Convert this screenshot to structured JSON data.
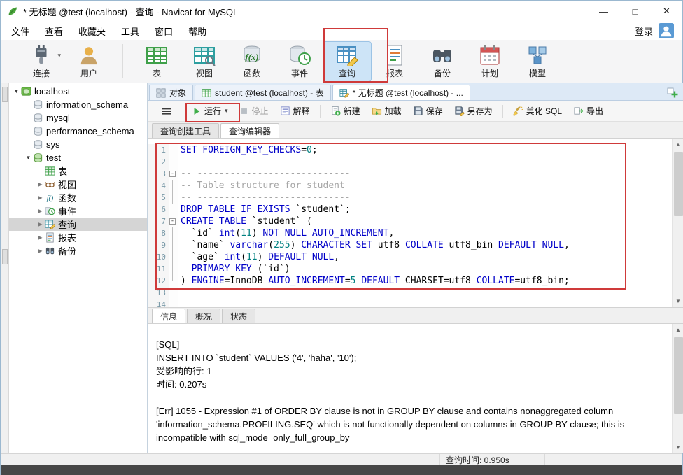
{
  "titlebar": {
    "title": "* 无标题 @test (localhost) - 查询 - Navicat for MySQL",
    "controls": {
      "minimize": "—",
      "maximize": "□",
      "close": "✕"
    }
  },
  "menubar": {
    "items": [
      "文件",
      "查看",
      "收藏夹",
      "工具",
      "窗口",
      "帮助"
    ],
    "login_label": "登录"
  },
  "toolbar": {
    "items": [
      {
        "label": "连接",
        "icon": "connection",
        "dropdown": true
      },
      {
        "label": "用户",
        "icon": "user",
        "sep_after": true
      },
      {
        "label": "表",
        "icon": "table"
      },
      {
        "label": "视图",
        "icon": "view"
      },
      {
        "label": "函数",
        "icon": "function"
      },
      {
        "label": "事件",
        "icon": "event"
      },
      {
        "label": "查询",
        "icon": "query",
        "selected": true
      },
      {
        "label": "报表",
        "icon": "report"
      },
      {
        "label": "备份",
        "icon": "backup"
      },
      {
        "label": "计划",
        "icon": "plan"
      },
      {
        "label": "模型",
        "icon": "model"
      }
    ]
  },
  "sidebar": {
    "items": [
      {
        "label": "localhost",
        "depth": 0,
        "icon": "db-localhost",
        "arrow": "down"
      },
      {
        "label": "information_schema",
        "depth": 1,
        "icon": "db-gray"
      },
      {
        "label": "mysql",
        "depth": 1,
        "icon": "db-gray"
      },
      {
        "label": "performance_schema",
        "depth": 1,
        "icon": "db-gray"
      },
      {
        "label": "sys",
        "depth": 1,
        "icon": "db-gray"
      },
      {
        "label": "test",
        "depth": 1,
        "icon": "db-green",
        "arrow": "down"
      },
      {
        "label": "表",
        "depth": 2,
        "icon": "tree-table"
      },
      {
        "label": "视图",
        "depth": 2,
        "icon": "tree-view",
        "arrow": "right"
      },
      {
        "label": "函数",
        "depth": 2,
        "icon": "tree-function",
        "arrow": "right"
      },
      {
        "label": "事件",
        "depth": 2,
        "icon": "tree-event",
        "arrow": "right"
      },
      {
        "label": "查询",
        "depth": 2,
        "icon": "tree-query",
        "arrow": "right",
        "selected": true
      },
      {
        "label": "报表",
        "depth": 2,
        "icon": "tree-report",
        "arrow": "right"
      },
      {
        "label": "备份",
        "depth": 2,
        "icon": "tree-backup",
        "arrow": "right"
      }
    ]
  },
  "tabbar": {
    "tabs": [
      {
        "label": "对象",
        "icon": "tab-objects"
      },
      {
        "label": "student @test (localhost) - 表",
        "icon": "tab-table"
      },
      {
        "label": "* 无标题 @test (localhost) - ...",
        "icon": "tab-query",
        "active": true
      }
    ]
  },
  "querybar": {
    "buttons": [
      {
        "id": "menu",
        "icon": "menu"
      },
      {
        "id": "run",
        "label": "运行",
        "icon": "run",
        "dropdown": true
      },
      {
        "id": "stop",
        "label": "停止",
        "icon": "stop",
        "disabled": true
      },
      {
        "id": "explain",
        "label": "解释",
        "icon": "explain",
        "sep_after": true
      },
      {
        "id": "new",
        "label": "新建",
        "icon": "new"
      },
      {
        "id": "load",
        "label": "加载",
        "icon": "load"
      },
      {
        "id": "save",
        "label": "保存",
        "icon": "save"
      },
      {
        "id": "saveas",
        "label": "另存为",
        "icon": "saveas",
        "sep_after": true
      },
      {
        "id": "beautify",
        "label": "美化 SQL",
        "icon": "beautify"
      },
      {
        "id": "export",
        "label": "导出",
        "icon": "export"
      }
    ]
  },
  "editor_tabs": [
    {
      "label": "查询创建工具"
    },
    {
      "label": "查询编辑器",
      "active": true
    }
  ],
  "editor": {
    "lines": [
      {
        "n": 1,
        "f": "",
        "t": [
          [
            "k",
            "SET FOREIGN_KEY_CHECKS"
          ],
          [
            "p",
            "="
          ],
          [
            "n",
            "0"
          ],
          [
            "p",
            ";"
          ]
        ]
      },
      {
        "n": 2,
        "f": "",
        "t": []
      },
      {
        "n": 3,
        "f": "box",
        "t": [
          [
            "c",
            "-- ----------------------------"
          ]
        ]
      },
      {
        "n": 4,
        "f": "v",
        "t": [
          [
            "c",
            "-- Table structure for student"
          ]
        ]
      },
      {
        "n": 5,
        "f": "v",
        "t": [
          [
            "c",
            "-- ----------------------------"
          ]
        ]
      },
      {
        "n": 6,
        "f": "",
        "t": [
          [
            "k",
            "DROP TABLE IF EXISTS"
          ],
          [
            "p",
            " `student`;"
          ]
        ]
      },
      {
        "n": 7,
        "f": "box",
        "t": [
          [
            "k",
            "CREATE TABLE"
          ],
          [
            "p",
            " `student` ("
          ]
        ]
      },
      {
        "n": 8,
        "f": "v",
        "t": [
          [
            "p",
            "  `id` "
          ],
          [
            "k",
            "int"
          ],
          [
            "p",
            "("
          ],
          [
            "n",
            "11"
          ],
          [
            "p",
            ") "
          ],
          [
            "k",
            "NOT NULL AUTO_INCREMENT"
          ],
          [
            "p",
            ","
          ]
        ]
      },
      {
        "n": 9,
        "f": "v",
        "t": [
          [
            "p",
            "  `name` "
          ],
          [
            "k",
            "varchar"
          ],
          [
            "p",
            "("
          ],
          [
            "n",
            "255"
          ],
          [
            "p",
            ") "
          ],
          [
            "k",
            "CHARACTER SET"
          ],
          [
            "p",
            " utf8 "
          ],
          [
            "k",
            "COLLATE"
          ],
          [
            "p",
            " utf8_bin "
          ],
          [
            "k",
            "DEFAULT NULL"
          ],
          [
            "p",
            ","
          ]
        ]
      },
      {
        "n": 10,
        "f": "v",
        "t": [
          [
            "p",
            "  `age` "
          ],
          [
            "k",
            "int"
          ],
          [
            "p",
            "("
          ],
          [
            "n",
            "11"
          ],
          [
            "p",
            ") "
          ],
          [
            "k",
            "DEFAULT NULL"
          ],
          [
            "p",
            ","
          ]
        ]
      },
      {
        "n": 11,
        "f": "v",
        "t": [
          [
            "p",
            "  "
          ],
          [
            "k",
            "PRIMARY KEY"
          ],
          [
            "p",
            " (`id`)"
          ]
        ]
      },
      {
        "n": 12,
        "f": "end",
        "t": [
          [
            "p",
            ") "
          ],
          [
            "k",
            "ENGINE"
          ],
          [
            "p",
            "=InnoDB "
          ],
          [
            "k",
            "AUTO_INCREMENT"
          ],
          [
            "p",
            "="
          ],
          [
            "n",
            "5"
          ],
          [
            "p",
            " "
          ],
          [
            "k",
            "DEFAULT"
          ],
          [
            "p",
            " CHARSET=utf8 "
          ],
          [
            "k",
            "COLLATE"
          ],
          [
            "p",
            "=utf8_bin;"
          ]
        ]
      },
      {
        "n": 13,
        "f": "",
        "t": []
      },
      {
        "n": 14,
        "f": "",
        "t": []
      }
    ]
  },
  "bottom_tabs": [
    {
      "label": "信息",
      "active": true
    },
    {
      "label": "概况"
    },
    {
      "label": "状态"
    }
  ],
  "messages": {
    "lines": [
      "[SQL]",
      "INSERT INTO `student` VALUES ('4', 'haha', '10');",
      "受影响的行: 1",
      "时间: 0.207s",
      "",
      "[Err] 1055 - Expression #1 of ORDER BY clause is not in GROUP BY clause and contains nonaggregated column 'information_schema.PROFILING.SEQ' which is not functionally dependent on columns in GROUP BY clause; this is incompatible with sql_mode=only_full_group_by"
    ]
  },
  "statusbar": {
    "query_time": "查询时间: 0.950s"
  },
  "colors": {
    "annotation_red": "#cf3a3a",
    "keyword_blue": "#0000c8",
    "comment_gray": "#a6a6a6",
    "number_teal": "#008080",
    "toolbar_selected": "#cde4f7"
  }
}
